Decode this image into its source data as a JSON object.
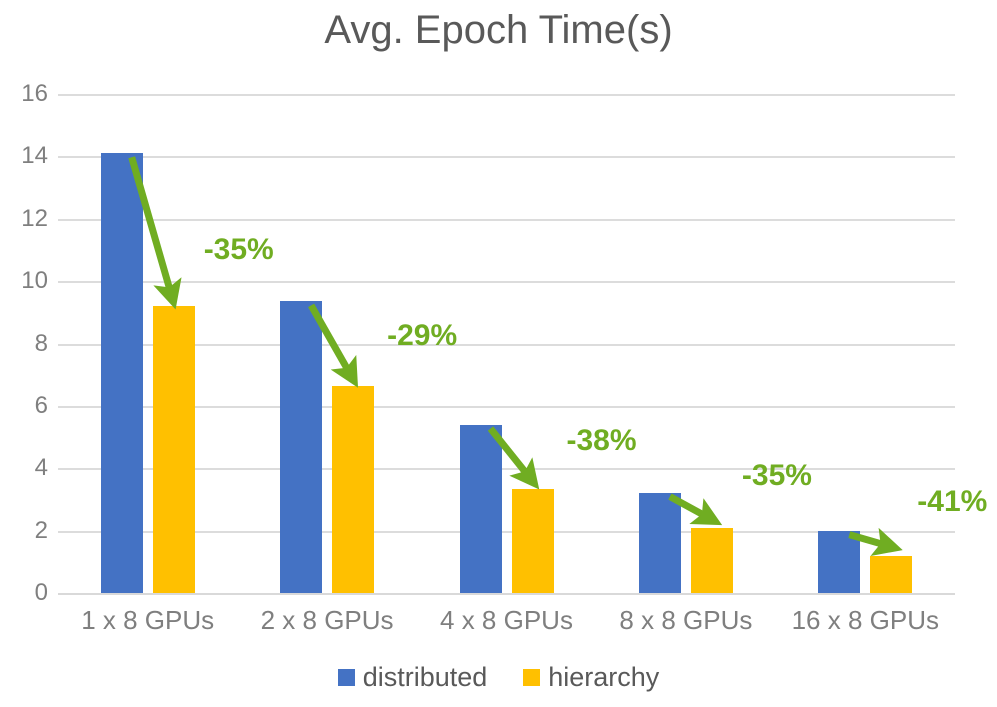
{
  "chart_data": {
    "type": "bar",
    "title": "Avg. Epoch Time(s)",
    "xlabel": "",
    "ylabel": "",
    "ylim": [
      0,
      16
    ],
    "ytick_step": 2,
    "grid": true,
    "legend_position": "bottom",
    "categories": [
      "1 x 8 GPUs",
      "2 x 8 GPUs",
      "4 x 8 GPUs",
      "8 x 8 GPUs",
      "16 x 8 GPUs"
    ],
    "ytick_labels": [
      "16",
      "14",
      "12",
      "10",
      "8",
      "6",
      "4",
      "2",
      "0"
    ],
    "series": [
      {
        "name": "distributed",
        "color": "#4472C4",
        "values": [
          14.1,
          9.35,
          5.4,
          3.22,
          2.0
        ]
      },
      {
        "name": "hierarchy",
        "color": "#FFC000",
        "values": [
          9.2,
          6.65,
          3.35,
          2.07,
          1.18
        ]
      }
    ],
    "annotations": [
      {
        "text": "-35%",
        "category": "1 x 8 GPUs",
        "color": "#70AD22"
      },
      {
        "text": "-29%",
        "category": "2 x 8 GPUs",
        "color": "#70AD22"
      },
      {
        "text": "-38%",
        "category": "4 x 8 GPUs",
        "color": "#70AD22"
      },
      {
        "text": "-35%",
        "category": "8 x 8 GPUs",
        "color": "#70AD22"
      },
      {
        "text": "-41%",
        "category": "16 x 8 GPUs",
        "color": "#70AD22"
      }
    ]
  },
  "colors": {
    "distributed": "#4472C4",
    "hierarchy": "#FFC000",
    "annotation": "#70AD22",
    "title_text": "#595959",
    "tick_text": "#7F7F7F",
    "gridline": "#DCDCDC"
  },
  "legend": {
    "items": [
      {
        "label": "distributed",
        "key": "distributed"
      },
      {
        "label": "hierarchy",
        "key": "hierarchy"
      }
    ]
  }
}
